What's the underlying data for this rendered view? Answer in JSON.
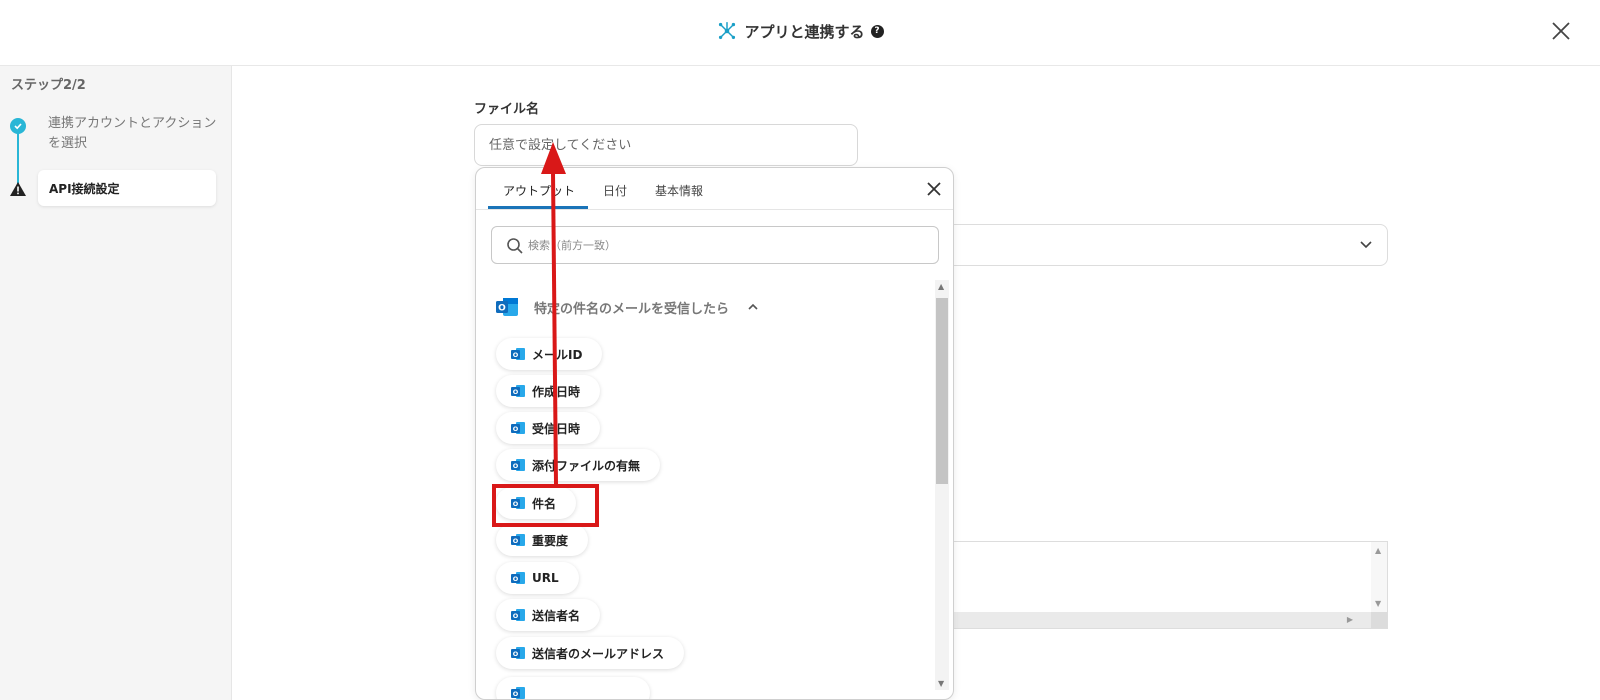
{
  "header": {
    "title": "アプリと連携する",
    "help_glyph": "?"
  },
  "sidebar": {
    "step_title": "ステップ2/2",
    "steps": [
      {
        "label": "連携アカウントとアクションを選択",
        "status": "complete"
      },
      {
        "label": "API接続設定",
        "status": "warning"
      }
    ]
  },
  "form": {
    "file_name_label": "ファイル名",
    "file_name_placeholder": "任意で設定してください"
  },
  "panel": {
    "tabs": [
      {
        "label": "アウトプット",
        "active": true
      },
      {
        "label": "日付",
        "active": false
      },
      {
        "label": "基本情報",
        "active": false
      }
    ],
    "search_placeholder": "検索（前方一致）",
    "group_title": "特定の件名のメールを受信したら",
    "items": [
      {
        "label": "メールID"
      },
      {
        "label": "作成日時"
      },
      {
        "label": "受信日時"
      },
      {
        "label": "添付ファイルの有無"
      },
      {
        "label": "件名",
        "highlighted": true
      },
      {
        "label": "重要度"
      },
      {
        "label": "URL"
      },
      {
        "label": "送信者名"
      },
      {
        "label": "送信者のメールアドレス"
      },
      {
        "label": ""
      }
    ]
  },
  "colors": {
    "accent": "#29b6d6",
    "tab_underline": "#1a74b8",
    "annotation_red": "#d91818",
    "outlook_blue": "#0f6cbd"
  }
}
